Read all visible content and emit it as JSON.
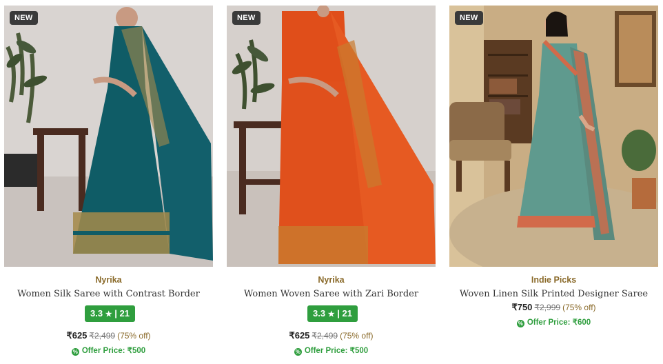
{
  "products": [
    {
      "badge": "NEW",
      "brand": "Nyrika",
      "title": "Women Silk Saree with Contrast Border",
      "rating": "3.3",
      "rating_count": "21",
      "price": "₹625",
      "mrp": "₹2,499",
      "discount": "(75% off)",
      "offer_price": "Offer Price: ₹500",
      "image_alt": "woman-in-teal-silk-saree"
    },
    {
      "badge": "NEW",
      "brand": "Nyrika",
      "title": "Women Woven Saree with Zari Border",
      "rating": "3.3",
      "rating_count": "21",
      "price": "₹625",
      "mrp": "₹2,499",
      "discount": "(75% off)",
      "offer_price": "Offer Price: ₹500",
      "image_alt": "woman-in-orange-woven-saree"
    },
    {
      "badge": "NEW",
      "brand": "Indie Picks",
      "title": "Woven Linen Silk Printed Designer Saree",
      "price": "₹750",
      "mrp": "₹2,999",
      "discount": "(75% off)",
      "offer_price": "Offer Price: ₹600",
      "image_alt": "woman-in-printed-linen-saree"
    }
  ],
  "colors": {
    "brand_gold": "#8a6a2a",
    "rating_green": "#2f9e3e",
    "teal_saree": "#0f5c66",
    "orange_saree": "#e0501c",
    "printed_saree": "#5f9a8e"
  },
  "icons": {
    "rating_star": "★",
    "offer": "offer-percent-icon"
  }
}
